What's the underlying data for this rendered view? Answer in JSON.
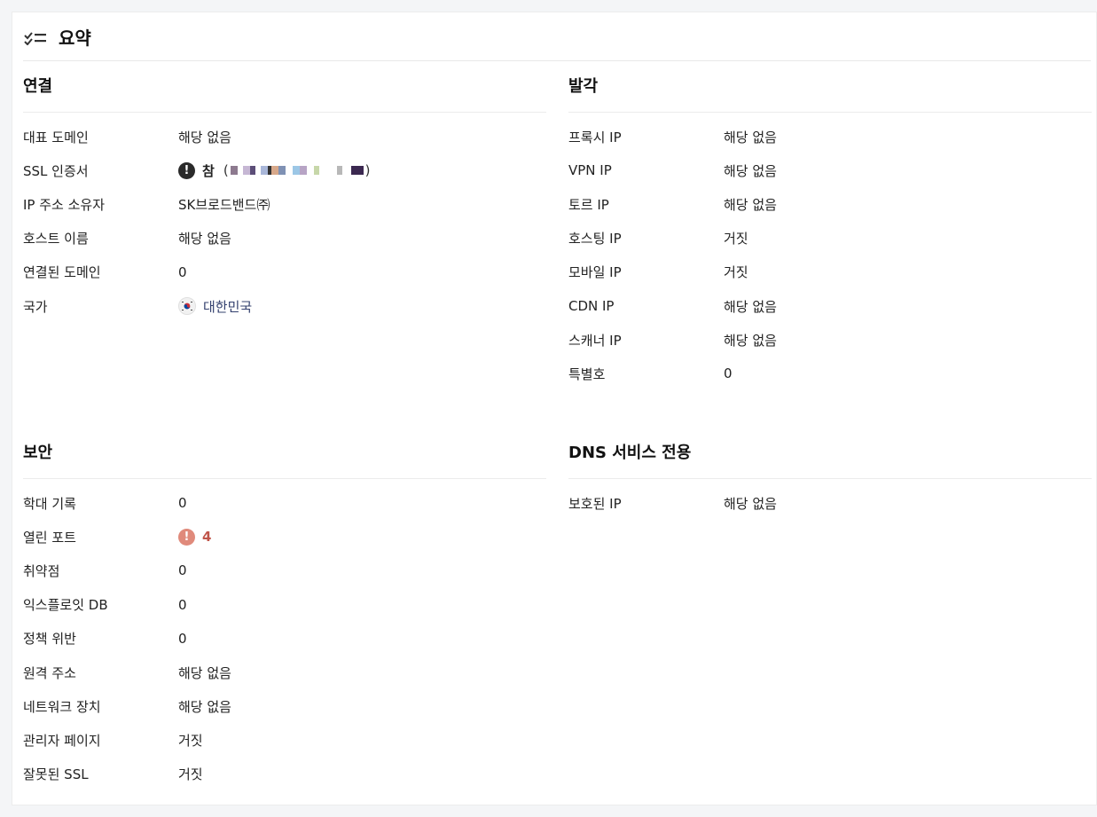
{
  "header": {
    "title": "요약",
    "icon": "checklist-icon"
  },
  "connection": {
    "title": "연결",
    "rows": {
      "main_domain": {
        "label": "대표 도메인",
        "value": "해당 없음"
      },
      "ssl": {
        "label": "SSL 인증서",
        "value": "참",
        "open_paren": "(",
        "close_paren": ")"
      },
      "ip_owner": {
        "label": "IP 주소 소유자",
        "value": "SK브로드밴드㈜"
      },
      "hostname": {
        "label": "호스트 이름",
        "value": "해당 없음"
      },
      "linked_domains": {
        "label": "연결된 도메인",
        "value": "0"
      },
      "country": {
        "label": "국가",
        "value": "대한민국"
      }
    }
  },
  "origin": {
    "title": "발각",
    "rows": {
      "proxy": {
        "label": "프록시 IP",
        "value": "해당 없음"
      },
      "vpn": {
        "label": "VPN IP",
        "value": "해당 없음"
      },
      "tor": {
        "label": "토르 IP",
        "value": "해당 없음"
      },
      "hosting": {
        "label": "호스팅 IP",
        "value": "거짓"
      },
      "mobile": {
        "label": "모바일 IP",
        "value": "거짓"
      },
      "cdn": {
        "label": "CDN IP",
        "value": "해당 없음"
      },
      "scanner": {
        "label": "스캐너 IP",
        "value": "해당 없음"
      },
      "special": {
        "label": "특별호",
        "value": "0"
      }
    }
  },
  "security": {
    "title": "보안",
    "rows": {
      "abuse": {
        "label": "학대 기록",
        "value": "0"
      },
      "open_ports": {
        "label": "열린 포트",
        "value": "4"
      },
      "vulns": {
        "label": "취약점",
        "value": "0"
      },
      "exploit_db": {
        "label": "익스플로잇 DB",
        "value": "0"
      },
      "policy": {
        "label": "정책 위반",
        "value": "0"
      },
      "remote": {
        "label": "원격 주소",
        "value": "해당 없음"
      },
      "network_device": {
        "label": "네트워크 장치",
        "value": "해당 없음"
      },
      "admin_page": {
        "label": "관리자 페이지",
        "value": "거짓"
      },
      "bad_ssl": {
        "label": "잘못된 SSL",
        "value": "거짓"
      }
    }
  },
  "dns": {
    "title": "DNS 서비스 전용",
    "rows": {
      "protected_ip": {
        "label": "보호된 IP",
        "value": "해당 없음"
      }
    }
  },
  "colors": {
    "muted": "#a9a9a9",
    "link": "#33406e",
    "danger": "#c0554a",
    "warning_icon": "#e08a7b"
  }
}
